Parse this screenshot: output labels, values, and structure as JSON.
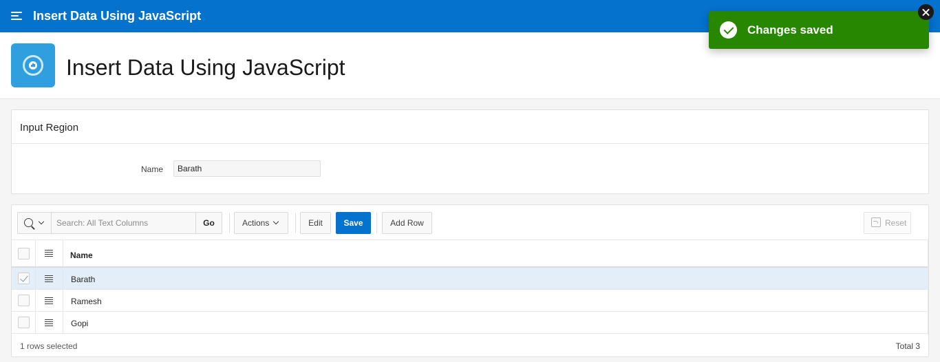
{
  "header": {
    "title": "Insert Data Using JavaScript"
  },
  "page": {
    "title": "Insert Data Using JavaScript"
  },
  "input_region": {
    "title": "Input Region",
    "name_label": "Name",
    "name_value": "Barath"
  },
  "grid": {
    "search_placeholder": "Search: All Text Columns",
    "go_label": "Go",
    "actions_label": "Actions",
    "edit_label": "Edit",
    "save_label": "Save",
    "add_row_label": "Add Row",
    "reset_label": "Reset",
    "column_name": "Name",
    "rows": [
      {
        "name": "Barath",
        "selected": true
      },
      {
        "name": "Ramesh",
        "selected": false
      },
      {
        "name": "Gopi",
        "selected": false
      }
    ],
    "footer_selected": "1 rows selected",
    "footer_total": "Total 3"
  },
  "toast": {
    "message": "Changes saved"
  },
  "colors": {
    "accent": "#0572ce",
    "success": "#278701",
    "hero_icon": "#2f9fe0"
  }
}
